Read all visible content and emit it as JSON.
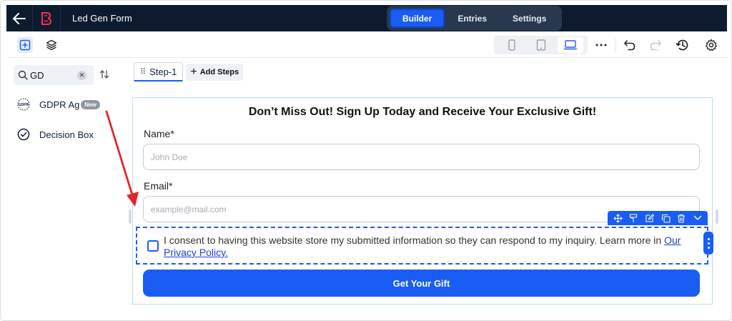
{
  "header": {
    "form_title": "Led Gen Form",
    "tabs": [
      {
        "label": "Builder",
        "active": true
      },
      {
        "label": "Entries",
        "active": false
      },
      {
        "label": "Settings",
        "active": false
      }
    ]
  },
  "sidebar": {
    "search_value": "GD",
    "items": [
      {
        "label": "GDPR Ag",
        "badge": "New",
        "icon": "gdpr-icon"
      },
      {
        "label": "Decision Box",
        "icon": "check-circle-icon"
      }
    ]
  },
  "steps": {
    "tabs": [
      {
        "label": "Step-1"
      }
    ],
    "add_label": "Add Steps"
  },
  "form": {
    "heading": "Don’t Miss Out! Sign Up Today and Receive Your Exclusive Gift!",
    "name_label": "Name*",
    "name_placeholder": "John Doe",
    "email_label": "Email*",
    "email_placeholder": "example@mail.com",
    "consent_text": "I consent to having this website store my submitted information so they can respond to my inquiry. Learn more in ",
    "consent_link": "Our Privacy Policy.",
    "submit_label": "Get Your Gift"
  },
  "colors": {
    "header_bg": "#0d1b2e",
    "accent": "#1a5df5",
    "annotation_arrow": "#e0262b"
  }
}
